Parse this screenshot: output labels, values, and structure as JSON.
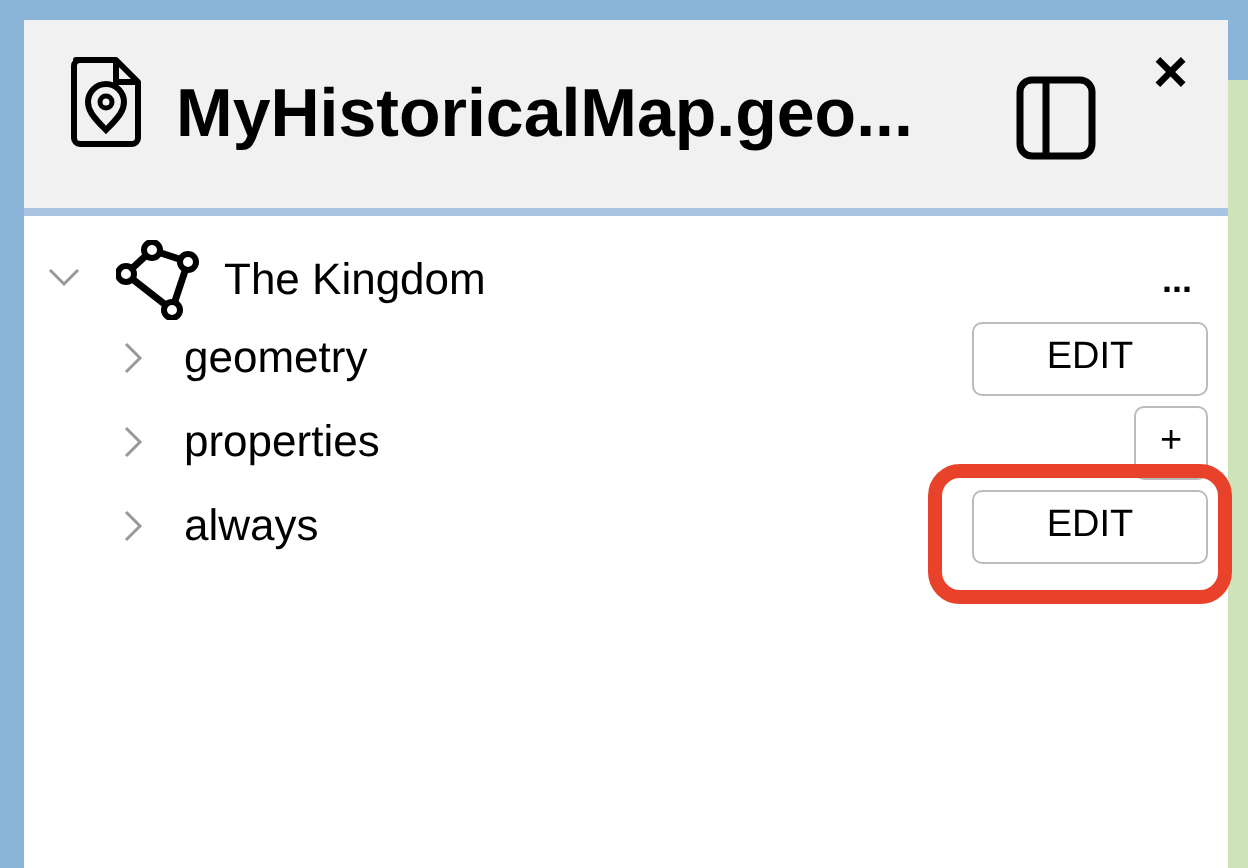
{
  "panel": {
    "title": "MyHistoricalMap.geo...",
    "close": "×"
  },
  "tree": {
    "label": "The Kingdom",
    "expanded": true,
    "menu": "...",
    "children": [
      {
        "label": "geometry",
        "expanded": false,
        "highlighted": false,
        "action": {
          "kind": "button",
          "label": "EDIT"
        }
      },
      {
        "label": "properties",
        "expanded": false,
        "highlighted": false,
        "action": {
          "kind": "small",
          "label": "+"
        }
      },
      {
        "label": "always",
        "expanded": false,
        "highlighted": true,
        "action": {
          "kind": "button",
          "label": "EDIT"
        }
      }
    ]
  }
}
